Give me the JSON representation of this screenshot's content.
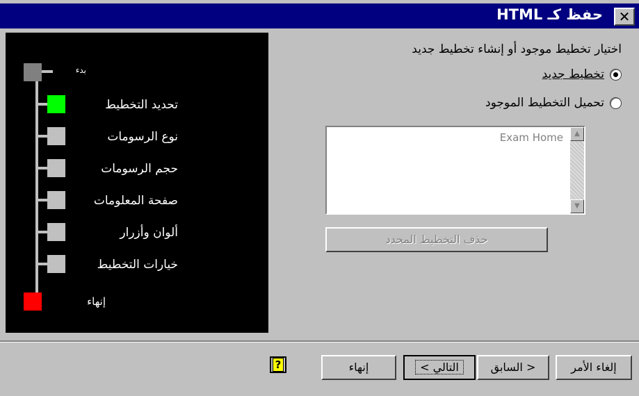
{
  "window": {
    "title": "حفظ كـ HTML",
    "close_glyph": "✕"
  },
  "steps": [
    {
      "label": "بدء",
      "color": "#808080"
    },
    {
      "label": "تحديد التخطيط",
      "color": "#00ff00"
    },
    {
      "label": "نوع الرسومات",
      "color": "#c0c0c0"
    },
    {
      "label": "حجم الرسومات",
      "color": "#c0c0c0"
    },
    {
      "label": "صفحة المعلومات",
      "color": "#c0c0c0"
    },
    {
      "label": "ألوان وأزرار",
      "color": "#c0c0c0"
    },
    {
      "label": "خيارات التخطيط",
      "color": "#c0c0c0"
    },
    {
      "label": "إنهاء",
      "color": "#ff0000"
    }
  ],
  "content": {
    "prompt": "اختيار تخطيط موجود أو إنشاء تخطيط جديد",
    "options": [
      {
        "label": "تخطيط جديد",
        "checked": true
      },
      {
        "label": "تحميل التخطيط الموجود",
        "checked": false
      }
    ],
    "layouts_list": [
      "Exam Home"
    ],
    "delete_button": "حذف التخطيط المحدد"
  },
  "footer": {
    "cancel": "إلغاء الأمر",
    "back": "< السابق",
    "next": "التالي >",
    "finish": "إنهاء",
    "help_glyph": "?"
  }
}
